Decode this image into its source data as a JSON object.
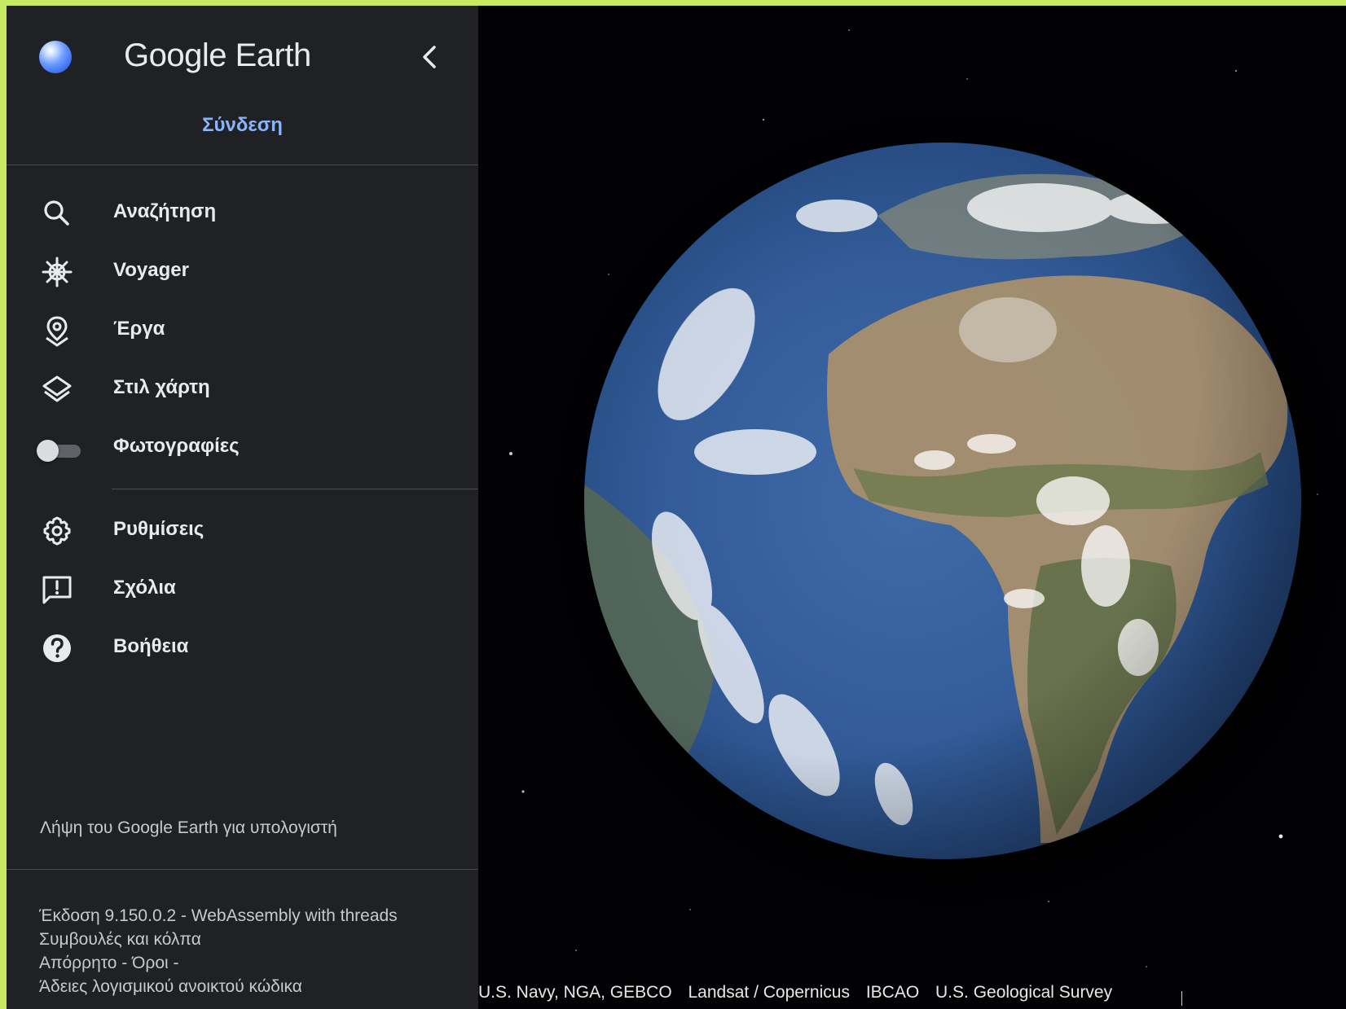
{
  "app": {
    "logo_text": "Google Earth",
    "sign_in": "Σύνδεση"
  },
  "menu": {
    "search": "Αναζήτηση",
    "voyager": "Voyager",
    "projects": "Έργα",
    "map_style": "Στιλ χάρτη",
    "photos": "Φωτογραφίες",
    "settings": "Ρυθμίσεις",
    "feedback": "Σχόλια",
    "help": "Βοήθεια"
  },
  "photos_toggle": {
    "on": false
  },
  "download": "Λήψη του Google Earth για υπολογιστή",
  "footer": {
    "version": "Έκδοση 9.150.0.2 - WebAssembly with threads",
    "tips": "Συμβουλές και κόλπα",
    "privacy": "Απόρρητο",
    "sep1": " - ",
    "terms": "Όροι",
    "sep2": " -",
    "licenses": "Άδειες λογισμικού ανοικτού κώδικα"
  },
  "attribution": {
    "items": [
      "U.S. Navy, NGA, GEBCO",
      "Landsat / Copernicus",
      "IBCAO",
      "U.S. Geological Survey"
    ]
  },
  "colors": {
    "panel_bg": "#202124",
    "accent": "#8ab4f8",
    "outer_frame": "#c8ea63"
  }
}
